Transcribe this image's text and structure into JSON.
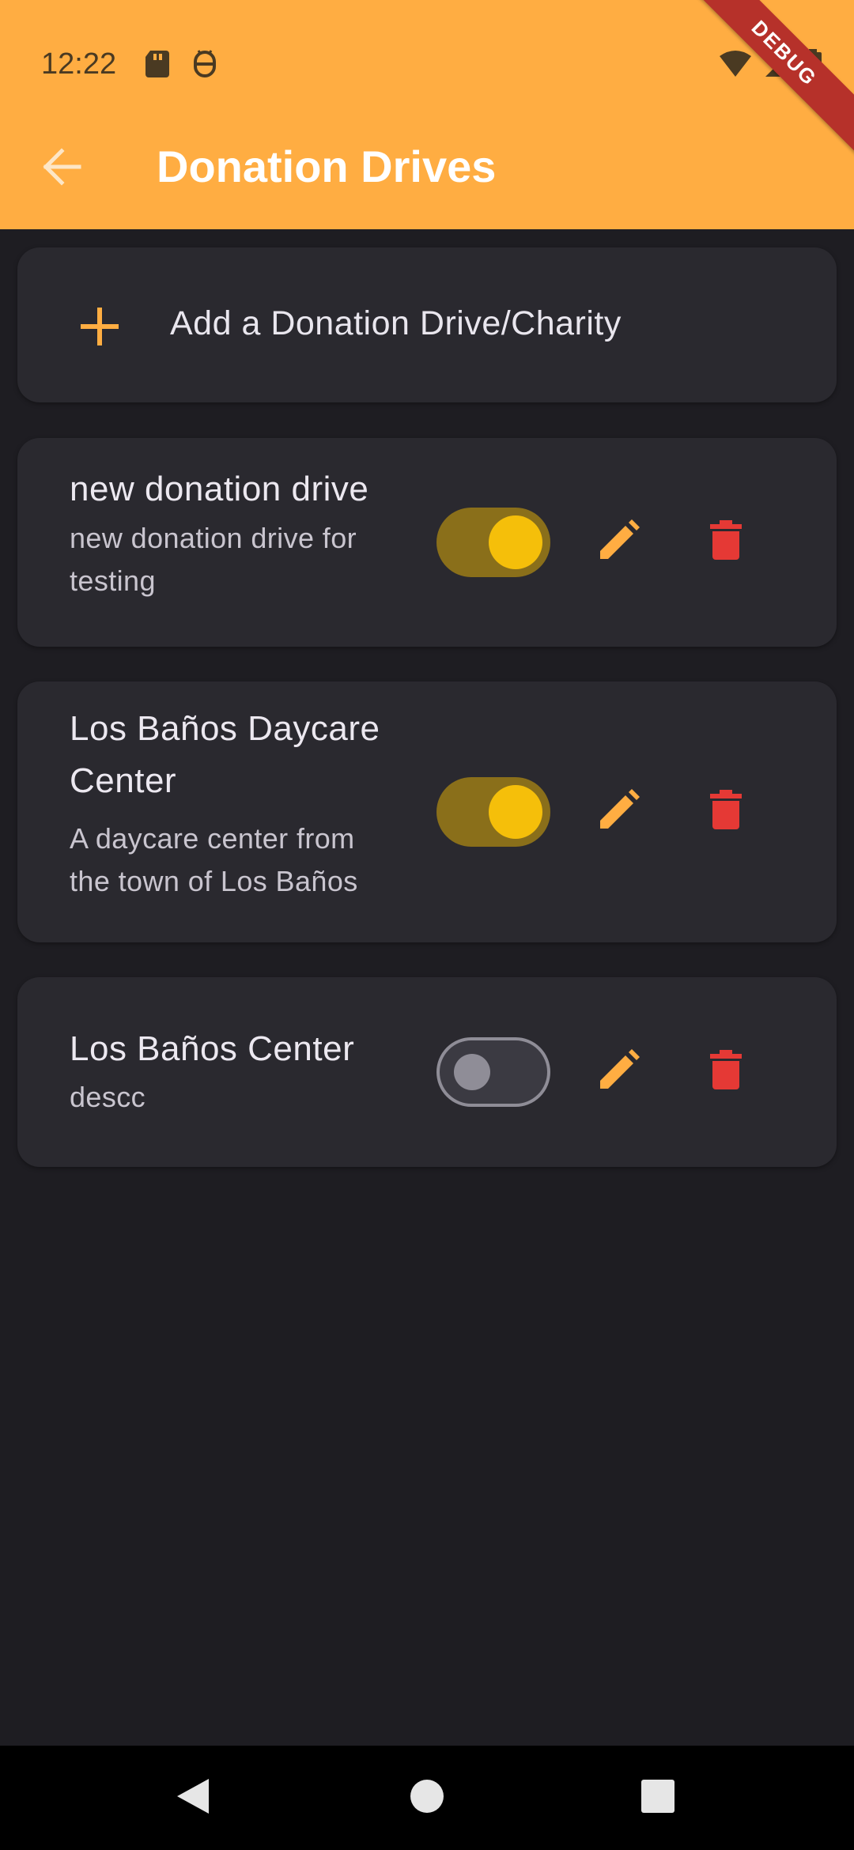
{
  "status_bar": {
    "time": "12:22",
    "left_icons": [
      "sd-card-icon",
      "android-debug-icon"
    ],
    "right_icons": [
      "wifi-icon",
      "signal-icon",
      "battery-icon"
    ]
  },
  "debug_banner": "DEBUG",
  "app_bar": {
    "title": "Donation Drives",
    "back_icon": "arrow-back-icon",
    "background": "#ffad42"
  },
  "add_card": {
    "label": "Add a Donation Drive/Charity",
    "icon": "plus-icon"
  },
  "drives": [
    {
      "title": "new donation drive",
      "description": "new donation drive for testing",
      "enabled": true
    },
    {
      "title": "Los Baños Daycare Center",
      "description": "A daycare center from the town of Los Baños",
      "enabled": true
    },
    {
      "title": "Los Baños Center",
      "description": "descc",
      "enabled": false
    }
  ],
  "colors": {
    "accent": "#ffad42",
    "toggle_on_track": "#8a6f1a",
    "toggle_on_knob": "#f5bf0a",
    "delete": "#e53935",
    "card": "#2a292f",
    "background": "#1e1d22"
  },
  "nav_bar": {
    "buttons": [
      "back-triangle-icon",
      "home-circle-icon",
      "recents-square-icon"
    ]
  }
}
